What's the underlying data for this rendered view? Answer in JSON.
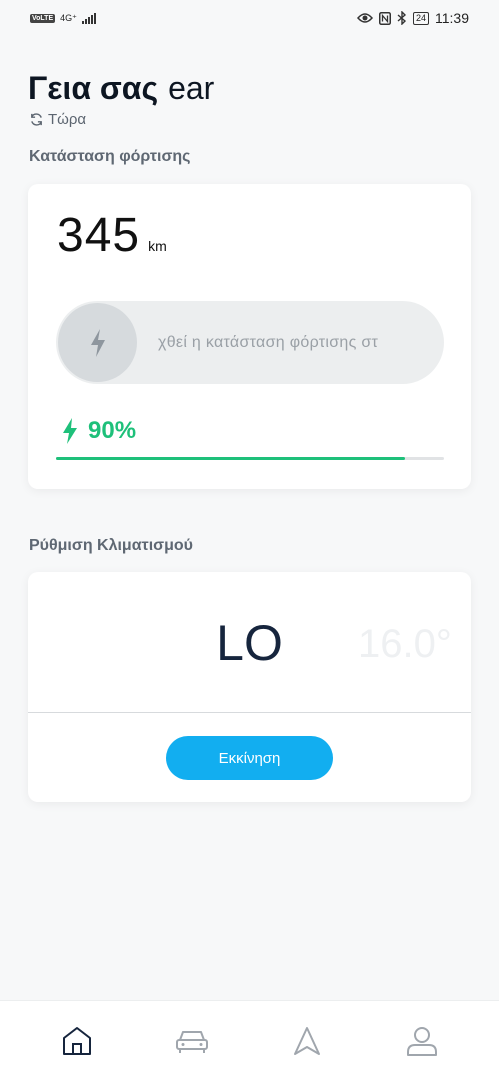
{
  "status_bar": {
    "volte": "VoLTE",
    "network": "4G⁺",
    "battery": "24",
    "time": "11:39"
  },
  "header": {
    "greeting": "Γεια σας",
    "name": "ear",
    "refresh_label": "Τώρα"
  },
  "charging": {
    "section_title": "Κατάσταση φόρτισης",
    "range_value": "345",
    "range_unit": "km",
    "slider_text": "χθεί η κατάσταση φόρτισης στ",
    "percentage_label": "90%",
    "percentage": 0.9
  },
  "climate": {
    "section_title": "Ρύθμιση Κλιματισμού",
    "temperature": "LO",
    "next_temperature": "16.0°",
    "start_label": "Εκκίνηση"
  },
  "bottom_nav": {
    "items": [
      "home-icon",
      "car-icon",
      "navigation-icon",
      "profile-icon"
    ],
    "active_color": "#16253d",
    "inactive_color": "#a0a6ad"
  },
  "colors": {
    "accent_green": "#1ec07a",
    "accent_blue": "#12aef0"
  }
}
